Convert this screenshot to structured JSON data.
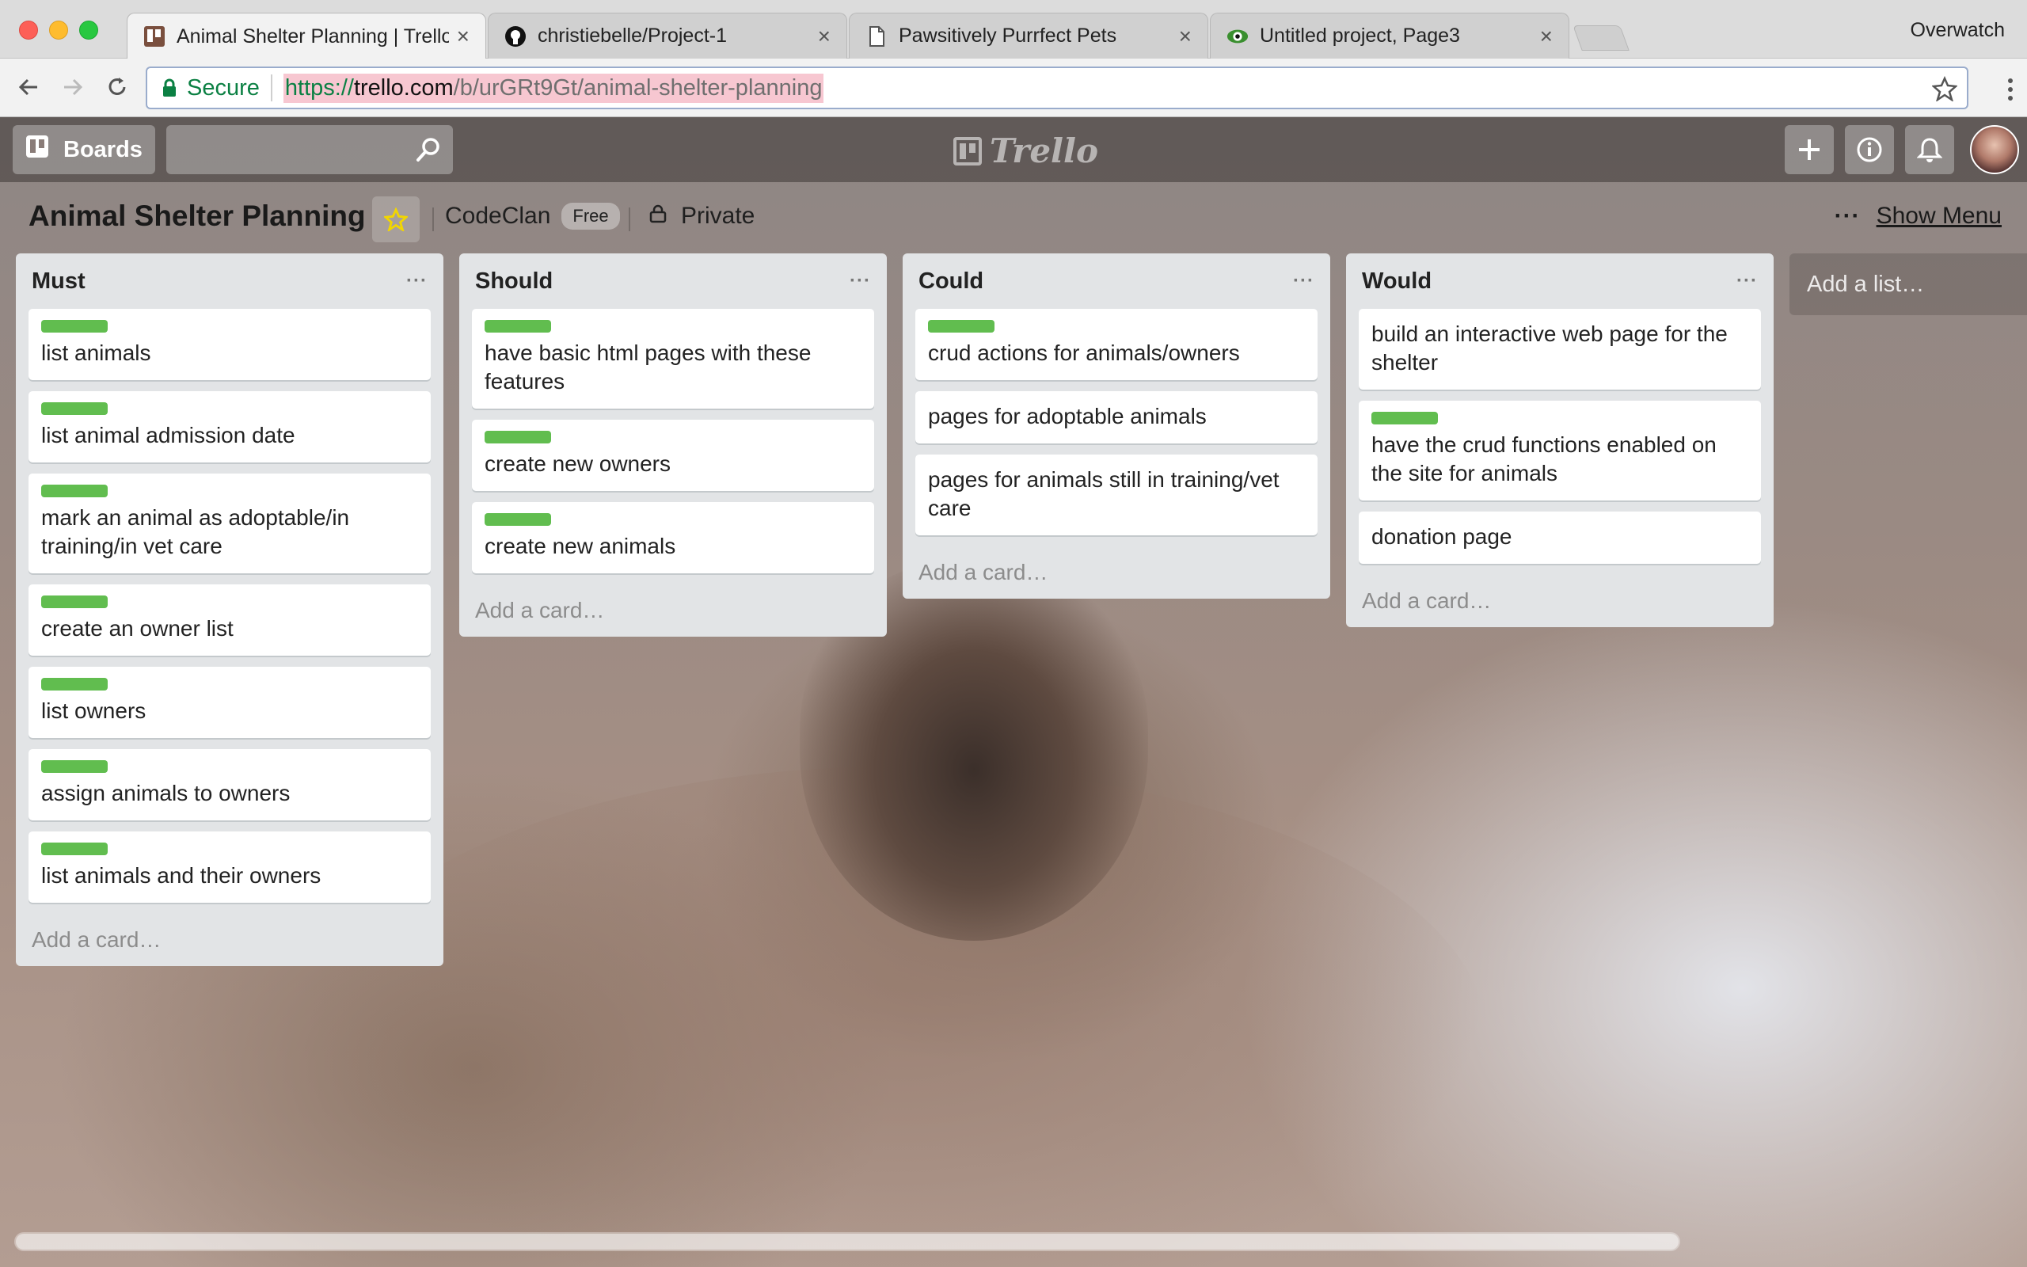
{
  "browser": {
    "profile": "Overwatch",
    "tabs": [
      {
        "title": "Animal Shelter Planning | Trello",
        "favicon": "trello-favicon-icon"
      },
      {
        "title": "christiebelle/Project-1",
        "favicon": "github-icon"
      },
      {
        "title": "Pawsitively Purrfect Pets",
        "favicon": "document-icon"
      },
      {
        "title": "Untitled project, Page3",
        "favicon": "eye-icon"
      }
    ],
    "close_glyph": "×",
    "secure_label": "Secure",
    "url": {
      "scheme": "https://",
      "host": "trello.com",
      "path": "/b/urGRt9Gt/animal-shelter-planning"
    }
  },
  "app": {
    "boards_label": "Boards",
    "logo_text": "Trello"
  },
  "board": {
    "title": "Animal Shelter Planning",
    "team": "CodeClan",
    "team_badge": "Free",
    "privacy": "Private",
    "menu_dots": "···",
    "show_menu": "Show Menu"
  },
  "lists": [
    {
      "title": "Must",
      "menu": "···",
      "cards": [
        {
          "text": "list animals",
          "label": true
        },
        {
          "text": "list animal admission date",
          "label": true
        },
        {
          "text": "mark an animal as adoptable/in training/in vet care",
          "label": true
        },
        {
          "text": "create an owner list",
          "label": true
        },
        {
          "text": "list owners",
          "label": true
        },
        {
          "text": "assign animals to owners",
          "label": true
        },
        {
          "text": "list animals and their owners",
          "label": true
        }
      ],
      "add_card": "Add a card…"
    },
    {
      "title": "Should",
      "menu": "···",
      "cards": [
        {
          "text": "have basic html pages with these features",
          "label": true
        },
        {
          "text": "create new owners",
          "label": true
        },
        {
          "text": "create new animals",
          "label": true
        }
      ],
      "add_card": "Add a card…"
    },
    {
      "title": "Could",
      "menu": "···",
      "cards": [
        {
          "text": "crud actions for animals/owners",
          "label": true
        },
        {
          "text": "pages for adoptable animals",
          "label": false
        },
        {
          "text": "pages for animals still in training/vet care",
          "label": false
        }
      ],
      "add_card": "Add a card…"
    },
    {
      "title": "Would",
      "menu": "···",
      "cards": [
        {
          "text": "build an interactive web page for the shelter",
          "label": false
        },
        {
          "text": "have the crud functions enabled on the site for animals",
          "label": true
        },
        {
          "text": "donation page",
          "label": false
        }
      ],
      "add_card": "Add a card…"
    }
  ],
  "add_list": "Add a list…",
  "colors": {
    "label_green": "#61bd4f",
    "secure_green": "#0b8043",
    "list_bg": "#e2e4e6"
  }
}
